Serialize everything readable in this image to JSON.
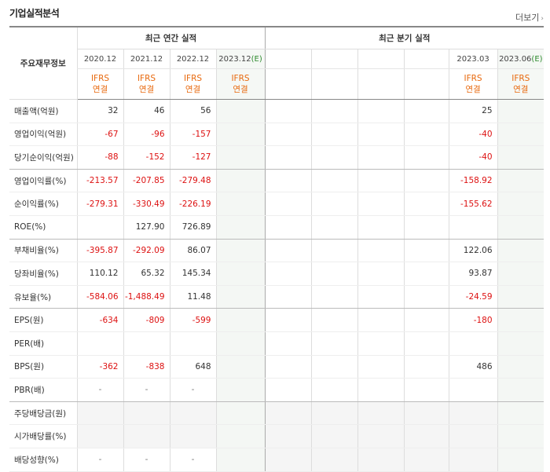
{
  "page": {
    "title": "기업실적분석",
    "more_label": "더보기"
  },
  "header": {
    "row_header": "주요재무정보",
    "annual_section": "최근 연간 실적",
    "quarter_section": "최근 분기 실적",
    "annual_years": [
      "2020.12",
      "2021.12",
      "2022.12"
    ],
    "annual_est_year": "2023.12",
    "est_suffix": "(E)",
    "quarter_year_a": "2023.03",
    "quarter_est_year": "2023.06",
    "ifrs_top": "IFRS",
    "ifrs_bottom": "연결"
  },
  "rows": [
    {
      "label": "매출액(억원)",
      "a": [
        "32",
        "46",
        "56"
      ],
      "q": "25"
    },
    {
      "label": "영업이익(억원)",
      "a": [
        "-67",
        "-96",
        "-157"
      ],
      "q": "-40"
    },
    {
      "label": "당기순이익(억원)",
      "a": [
        "-88",
        "-152",
        "-127"
      ],
      "q": "-40"
    },
    {
      "label": "영업이익률(%)",
      "a": [
        "-213.57",
        "-207.85",
        "-279.48"
      ],
      "q": "-158.92"
    },
    {
      "label": "순이익률(%)",
      "a": [
        "-279.31",
        "-330.49",
        "-226.19"
      ],
      "q": "-155.62"
    },
    {
      "label": "ROE(%)",
      "a": [
        "",
        "127.90",
        "726.89"
      ],
      "q": ""
    },
    {
      "label": "부채비율(%)",
      "a": [
        "-395.87",
        "-292.09",
        "86.07"
      ],
      "q": "122.06"
    },
    {
      "label": "당좌비율(%)",
      "a": [
        "110.12",
        "65.32",
        "145.34"
      ],
      "q": "93.87"
    },
    {
      "label": "유보율(%)",
      "a": [
        "-584.06",
        "-1,488.49",
        "11.48"
      ],
      "q": "-24.59"
    },
    {
      "label": "EPS(원)",
      "a": [
        "-634",
        "-809",
        "-599"
      ],
      "q": "-180"
    },
    {
      "label": "PER(배)",
      "a": [
        "",
        "",
        ""
      ],
      "q": ""
    },
    {
      "label": "BPS(원)",
      "a": [
        "-362",
        "-838",
        "648"
      ],
      "q": "486"
    },
    {
      "label": "PBR(배)",
      "a": [
        "-",
        "-",
        "-"
      ],
      "q": ""
    },
    {
      "label": "주당배당금(원)",
      "a": [
        "",
        "",
        ""
      ],
      "q": ""
    },
    {
      "label": "시가배당률(%)",
      "a": [
        "",
        "",
        ""
      ],
      "q": ""
    },
    {
      "label": "배당성향(%)",
      "a": [
        "-",
        "-",
        "-"
      ],
      "q": ""
    }
  ]
}
